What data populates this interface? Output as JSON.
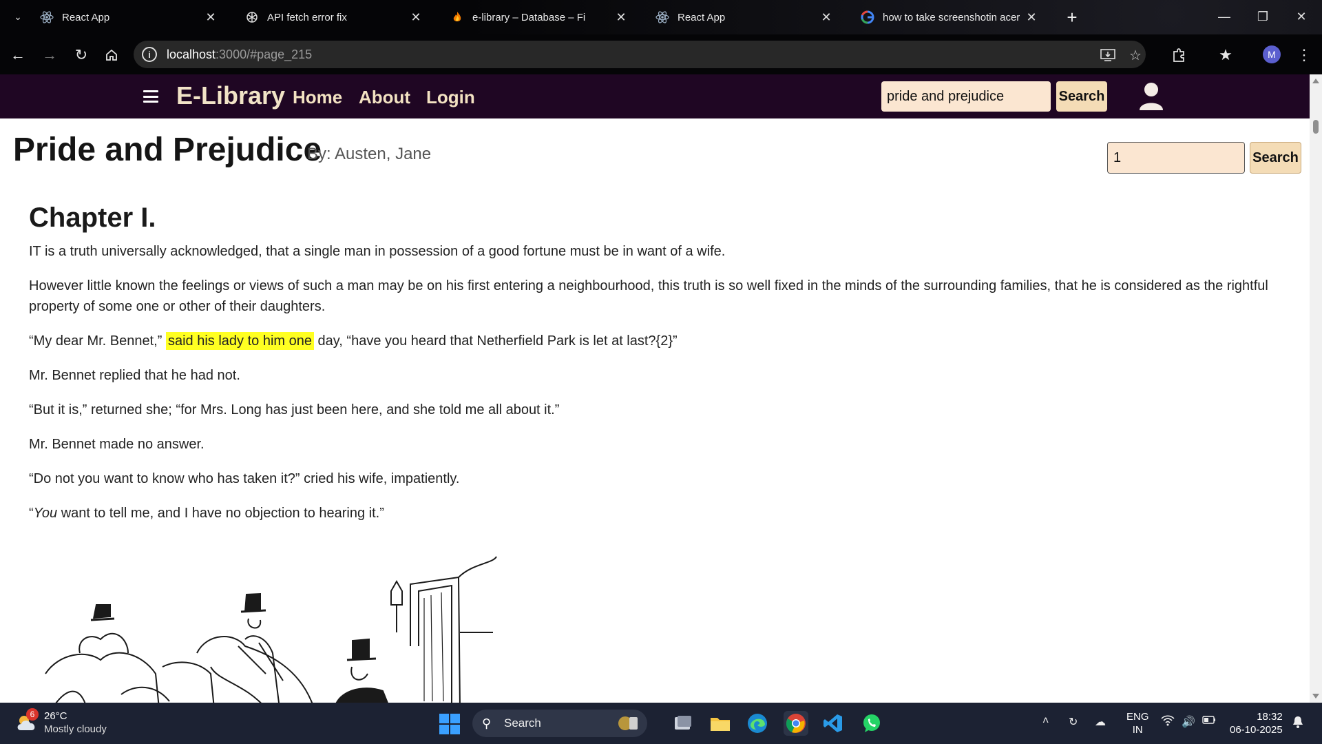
{
  "browser": {
    "tabs": [
      {
        "title": "React App",
        "icon": "react-icon"
      },
      {
        "title": "API fetch error fix",
        "icon": "openai-icon"
      },
      {
        "title": "e-library – Database – Fi",
        "icon": "firebase-icon"
      },
      {
        "title": "React App",
        "icon": "react-icon"
      },
      {
        "title": "how to take screenshotin acer",
        "icon": "google-icon"
      }
    ],
    "url_host": "localhost",
    "url_rest": ":3000/#page_215",
    "profile_initial": "M"
  },
  "app": {
    "brand": "E-Library",
    "nav_links": [
      "Home",
      "About",
      "Login"
    ],
    "search_value": "pride and prejudice",
    "search_button": "Search"
  },
  "book": {
    "title": "Pride and Prejudice",
    "author": "By: Austen, Jane",
    "page_value": "1",
    "page_button": "Search",
    "chapter": "Chapter I.",
    "p1": "IT is a truth universally acknowledged, that a single man in possession of a good fortune must be in want of a wife.",
    "p2": "However little known the feelings or views of such a man may be on his first entering a neighbourhood, this truth is so well fixed in the minds of the surrounding families, that he is considered as the rightful property of some one or other of their daughters.",
    "p3_before": "“My dear Mr. Bennet,”",
    "p3_highlight": "said his lady to him one",
    "p3_after": "day, “have you heard that Netherfield Park is let at last?{2}”",
    "p4": "Mr. Bennet replied that he had not.",
    "p5": "“But it is,” returned she; “for Mrs. Long has just been here, and she told me all about it.”",
    "p6": "Mr. Bennet made no answer.",
    "p7": "“Do not you want to know who has taken it?” cried his wife, impatiently.",
    "p8_open": "“",
    "p8_em": "You",
    "p8_rest": " want to tell me, and I have no objection to hearing it.”"
  },
  "taskbar": {
    "weather_badge": "6",
    "temperature": "26°C",
    "weather": "Mostly cloudy",
    "search_label": "Search",
    "lang_line1": "ENG",
    "lang_line2": "IN",
    "time": "18:32",
    "date": "06-10-2025"
  },
  "colors": {
    "nav_bg": "#1f0623",
    "brand": "#f1e3c7",
    "input_bg": "#fbe6d1",
    "button_bg": "#f4dcb6",
    "highlight": "#ffff22"
  }
}
